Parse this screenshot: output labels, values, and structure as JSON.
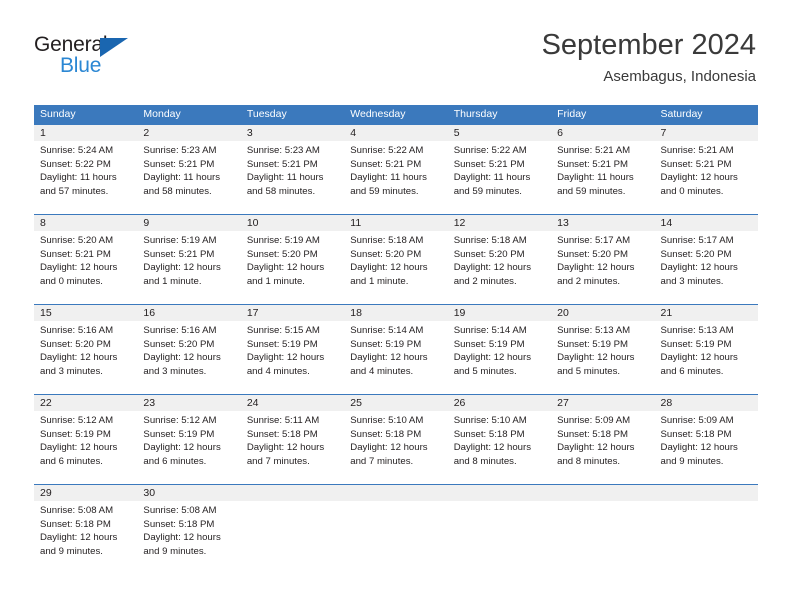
{
  "brand": {
    "name_top": "General",
    "name_bottom": "Blue",
    "accent_color": "#2b87d3",
    "triangle_color": "#1a66b0"
  },
  "header": {
    "title": "September 2024",
    "subtitle": "Asembagus, Indonesia"
  },
  "theme": {
    "header_row_bg": "#3b79bd",
    "daynum_band_bg": "#f0f0f0",
    "text_color": "#231f20"
  },
  "calendar": {
    "weekday_headers": [
      "Sunday",
      "Monday",
      "Tuesday",
      "Wednesday",
      "Thursday",
      "Friday",
      "Saturday"
    ],
    "weeks": [
      {
        "days": [
          {
            "num": "1",
            "sunrise": "Sunrise: 5:24 AM",
            "sunset": "Sunset: 5:22 PM",
            "daylight": "Daylight: 11 hours and 57 minutes."
          },
          {
            "num": "2",
            "sunrise": "Sunrise: 5:23 AM",
            "sunset": "Sunset: 5:21 PM",
            "daylight": "Daylight: 11 hours and 58 minutes."
          },
          {
            "num": "3",
            "sunrise": "Sunrise: 5:23 AM",
            "sunset": "Sunset: 5:21 PM",
            "daylight": "Daylight: 11 hours and 58 minutes."
          },
          {
            "num": "4",
            "sunrise": "Sunrise: 5:22 AM",
            "sunset": "Sunset: 5:21 PM",
            "daylight": "Daylight: 11 hours and 59 minutes."
          },
          {
            "num": "5",
            "sunrise": "Sunrise: 5:22 AM",
            "sunset": "Sunset: 5:21 PM",
            "daylight": "Daylight: 11 hours and 59 minutes."
          },
          {
            "num": "6",
            "sunrise": "Sunrise: 5:21 AM",
            "sunset": "Sunset: 5:21 PM",
            "daylight": "Daylight: 11 hours and 59 minutes."
          },
          {
            "num": "7",
            "sunrise": "Sunrise: 5:21 AM",
            "sunset": "Sunset: 5:21 PM",
            "daylight": "Daylight: 12 hours and 0 minutes."
          }
        ]
      },
      {
        "days": [
          {
            "num": "8",
            "sunrise": "Sunrise: 5:20 AM",
            "sunset": "Sunset: 5:21 PM",
            "daylight": "Daylight: 12 hours and 0 minutes."
          },
          {
            "num": "9",
            "sunrise": "Sunrise: 5:19 AM",
            "sunset": "Sunset: 5:21 PM",
            "daylight": "Daylight: 12 hours and 1 minute."
          },
          {
            "num": "10",
            "sunrise": "Sunrise: 5:19 AM",
            "sunset": "Sunset: 5:20 PM",
            "daylight": "Daylight: 12 hours and 1 minute."
          },
          {
            "num": "11",
            "sunrise": "Sunrise: 5:18 AM",
            "sunset": "Sunset: 5:20 PM",
            "daylight": "Daylight: 12 hours and 1 minute."
          },
          {
            "num": "12",
            "sunrise": "Sunrise: 5:18 AM",
            "sunset": "Sunset: 5:20 PM",
            "daylight": "Daylight: 12 hours and 2 minutes."
          },
          {
            "num": "13",
            "sunrise": "Sunrise: 5:17 AM",
            "sunset": "Sunset: 5:20 PM",
            "daylight": "Daylight: 12 hours and 2 minutes."
          },
          {
            "num": "14",
            "sunrise": "Sunrise: 5:17 AM",
            "sunset": "Sunset: 5:20 PM",
            "daylight": "Daylight: 12 hours and 3 minutes."
          }
        ]
      },
      {
        "days": [
          {
            "num": "15",
            "sunrise": "Sunrise: 5:16 AM",
            "sunset": "Sunset: 5:20 PM",
            "daylight": "Daylight: 12 hours and 3 minutes."
          },
          {
            "num": "16",
            "sunrise": "Sunrise: 5:16 AM",
            "sunset": "Sunset: 5:20 PM",
            "daylight": "Daylight: 12 hours and 3 minutes."
          },
          {
            "num": "17",
            "sunrise": "Sunrise: 5:15 AM",
            "sunset": "Sunset: 5:19 PM",
            "daylight": "Daylight: 12 hours and 4 minutes."
          },
          {
            "num": "18",
            "sunrise": "Sunrise: 5:14 AM",
            "sunset": "Sunset: 5:19 PM",
            "daylight": "Daylight: 12 hours and 4 minutes."
          },
          {
            "num": "19",
            "sunrise": "Sunrise: 5:14 AM",
            "sunset": "Sunset: 5:19 PM",
            "daylight": "Daylight: 12 hours and 5 minutes."
          },
          {
            "num": "20",
            "sunrise": "Sunrise: 5:13 AM",
            "sunset": "Sunset: 5:19 PM",
            "daylight": "Daylight: 12 hours and 5 minutes."
          },
          {
            "num": "21",
            "sunrise": "Sunrise: 5:13 AM",
            "sunset": "Sunset: 5:19 PM",
            "daylight": "Daylight: 12 hours and 6 minutes."
          }
        ]
      },
      {
        "days": [
          {
            "num": "22",
            "sunrise": "Sunrise: 5:12 AM",
            "sunset": "Sunset: 5:19 PM",
            "daylight": "Daylight: 12 hours and 6 minutes."
          },
          {
            "num": "23",
            "sunrise": "Sunrise: 5:12 AM",
            "sunset": "Sunset: 5:19 PM",
            "daylight": "Daylight: 12 hours and 6 minutes."
          },
          {
            "num": "24",
            "sunrise": "Sunrise: 5:11 AM",
            "sunset": "Sunset: 5:18 PM",
            "daylight": "Daylight: 12 hours and 7 minutes."
          },
          {
            "num": "25",
            "sunrise": "Sunrise: 5:10 AM",
            "sunset": "Sunset: 5:18 PM",
            "daylight": "Daylight: 12 hours and 7 minutes."
          },
          {
            "num": "26",
            "sunrise": "Sunrise: 5:10 AM",
            "sunset": "Sunset: 5:18 PM",
            "daylight": "Daylight: 12 hours and 8 minutes."
          },
          {
            "num": "27",
            "sunrise": "Sunrise: 5:09 AM",
            "sunset": "Sunset: 5:18 PM",
            "daylight": "Daylight: 12 hours and 8 minutes."
          },
          {
            "num": "28",
            "sunrise": "Sunrise: 5:09 AM",
            "sunset": "Sunset: 5:18 PM",
            "daylight": "Daylight: 12 hours and 9 minutes."
          }
        ]
      },
      {
        "days": [
          {
            "num": "29",
            "sunrise": "Sunrise: 5:08 AM",
            "sunset": "Sunset: 5:18 PM",
            "daylight": "Daylight: 12 hours and 9 minutes."
          },
          {
            "num": "30",
            "sunrise": "Sunrise: 5:08 AM",
            "sunset": "Sunset: 5:18 PM",
            "daylight": "Daylight: 12 hours and 9 minutes."
          },
          {
            "num": "",
            "sunrise": "",
            "sunset": "",
            "daylight": ""
          },
          {
            "num": "",
            "sunrise": "",
            "sunset": "",
            "daylight": ""
          },
          {
            "num": "",
            "sunrise": "",
            "sunset": "",
            "daylight": ""
          },
          {
            "num": "",
            "sunrise": "",
            "sunset": "",
            "daylight": ""
          },
          {
            "num": "",
            "sunrise": "",
            "sunset": "",
            "daylight": ""
          }
        ]
      }
    ]
  }
}
